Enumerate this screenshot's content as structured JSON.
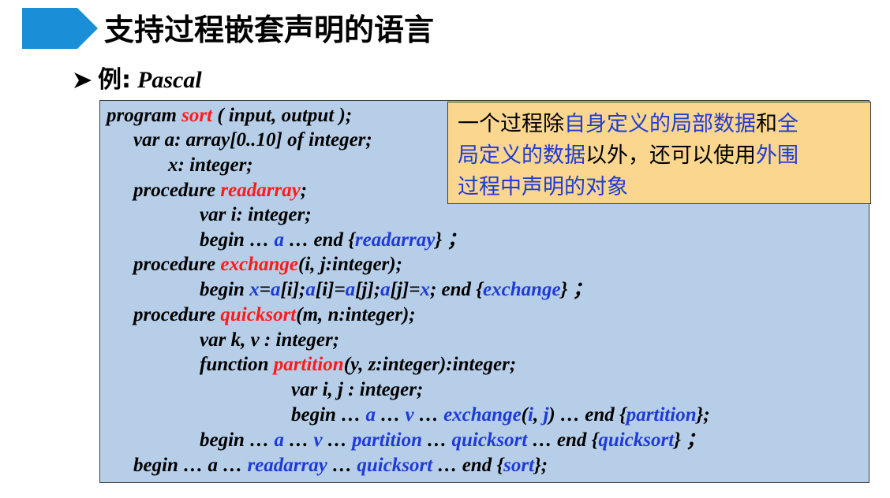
{
  "title": "支持过程嵌套声明的语言",
  "subtitle": {
    "prefix": "例:",
    "language": "Pascal"
  },
  "note": {
    "lines": [
      [
        {
          "t": "一个过程除",
          "c": "k"
        },
        {
          "t": "自身定义的局部数据",
          "c": "b"
        },
        {
          "t": "和",
          "c": "k"
        },
        {
          "t": "全",
          "c": "b"
        }
      ],
      [
        {
          "t": "局定义的数据",
          "c": "b"
        },
        {
          "t": "以外，还可以使用",
          "c": "k"
        },
        {
          "t": "外围",
          "c": "b"
        }
      ],
      [
        {
          "t": "过程中声明的对象",
          "c": "b"
        }
      ]
    ]
  },
  "code": [
    [
      {
        "t": "program ",
        "c": "k"
      },
      {
        "t": "sort",
        "c": "r"
      },
      {
        "t": " ( input, output );",
        "c": "k"
      }
    ],
    [
      {
        "t": "var a",
        "c": "k"
      },
      {
        "t": ": array[0..10] ",
        "c": "k"
      },
      {
        "t": "of integer;",
        "c": "k"
      }
    ],
    [
      {
        "t": "x",
        "c": "k"
      },
      {
        "t": ": integer;",
        "c": "k"
      }
    ],
    [
      {
        "t": "procedure ",
        "c": "k"
      },
      {
        "t": "readarray",
        "c": "r"
      },
      {
        "t": ";",
        "c": "k"
      }
    ],
    [
      {
        "t": "var i",
        "c": "k"
      },
      {
        "t": ": integer;",
        "c": "k"
      }
    ],
    [
      {
        "t": "begin … ",
        "c": "k"
      },
      {
        "t": "a",
        "c": "b"
      },
      {
        "t": " … end {",
        "c": "k"
      },
      {
        "t": "readarray",
        "c": "b"
      },
      {
        "t": "} ；",
        "c": "k"
      }
    ],
    [
      {
        "t": "procedure ",
        "c": "k"
      },
      {
        "t": "exchange",
        "c": "r"
      },
      {
        "t": "(i, j:integer);",
        "c": "k"
      }
    ],
    [
      {
        "t": "begin ",
        "c": "k"
      },
      {
        "t": "x",
        "c": "b"
      },
      {
        "t": "=",
        "c": "k"
      },
      {
        "t": "a",
        "c": "b"
      },
      {
        "t": "[i];",
        "c": "k"
      },
      {
        "t": "a",
        "c": "b"
      },
      {
        "t": "[i]=",
        "c": "k"
      },
      {
        "t": "a",
        "c": "b"
      },
      {
        "t": "[j];",
        "c": "k"
      },
      {
        "t": "a",
        "c": "b"
      },
      {
        "t": "[j]=",
        "c": "k"
      },
      {
        "t": "x",
        "c": "b"
      },
      {
        "t": "; end {",
        "c": "k"
      },
      {
        "t": "exchange",
        "c": "b"
      },
      {
        "t": "} ；",
        "c": "k"
      }
    ],
    [
      {
        "t": "procedure ",
        "c": "k"
      },
      {
        "t": "quicksort",
        "c": "r"
      },
      {
        "t": "(m, n:integer);",
        "c": "k"
      }
    ],
    [
      {
        "t": "var k, v : integer;",
        "c": "k"
      }
    ],
    [
      {
        "t": "function ",
        "c": "k"
      },
      {
        "t": "partition",
        "c": "r"
      },
      {
        "t": "(y, z:integer):integer;",
        "c": "k"
      }
    ],
    [
      {
        "t": "var i, j : integer;",
        "c": "k"
      }
    ],
    [
      {
        "t": "begin … ",
        "c": "k"
      },
      {
        "t": "a",
        "c": "b"
      },
      {
        "t": " … ",
        "c": "k"
      },
      {
        "t": "v",
        "c": "b"
      },
      {
        "t": " … ",
        "c": "k"
      },
      {
        "t": "exchange",
        "c": "b"
      },
      {
        "t": "(",
        "c": "k"
      },
      {
        "t": "i",
        "c": "b"
      },
      {
        "t": ", ",
        "c": "k"
      },
      {
        "t": "j",
        "c": "b"
      },
      {
        "t": ") … end {",
        "c": "k"
      },
      {
        "t": "partition",
        "c": "b"
      },
      {
        "t": "};",
        "c": "k"
      }
    ],
    [
      {
        "t": "begin … ",
        "c": "k"
      },
      {
        "t": "a",
        "c": "b"
      },
      {
        "t": " … ",
        "c": "k"
      },
      {
        "t": "v",
        "c": "b"
      },
      {
        "t": " … ",
        "c": "k"
      },
      {
        "t": "partition",
        "c": "b"
      },
      {
        "t": " … ",
        "c": "k"
      },
      {
        "t": "quicksort",
        "c": "b"
      },
      {
        "t": " … end {",
        "c": "k"
      },
      {
        "t": "quicksort",
        "c": "b"
      },
      {
        "t": "} ；",
        "c": "k"
      }
    ],
    [
      {
        "t": "begin … a … ",
        "c": "k"
      },
      {
        "t": "readarray",
        "c": "b"
      },
      {
        "t": " … ",
        "c": "k"
      },
      {
        "t": "quicksort",
        "c": "b"
      },
      {
        "t": " … end {",
        "c": "k"
      },
      {
        "t": "sort",
        "c": "b"
      },
      {
        "t": "};",
        "c": "k"
      }
    ]
  ],
  "colors": {
    "red": "#ff1a1a",
    "blue": "#1e3bd6",
    "code_bg": "#b7cee9",
    "note_bg": "#fad68f",
    "title_bar": "#1a8fd8"
  }
}
